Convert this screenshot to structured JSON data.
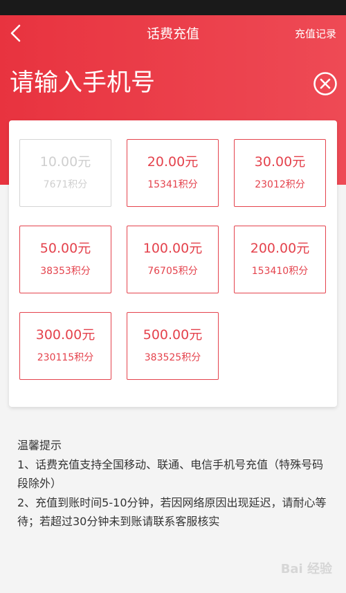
{
  "header": {
    "title": "话费充值",
    "records_link": "充值记录",
    "phone_placeholder": "请输入手机号",
    "background_color": "#e8333f"
  },
  "options": [
    {
      "amount": "10.00元",
      "points": "7671积分",
      "disabled": true
    },
    {
      "amount": "20.00元",
      "points": "15341积分",
      "disabled": false
    },
    {
      "amount": "30.00元",
      "points": "23012积分",
      "disabled": false
    },
    {
      "amount": "50.00元",
      "points": "38353积分",
      "disabled": false
    },
    {
      "amount": "100.00元",
      "points": "76705积分",
      "disabled": false
    },
    {
      "amount": "200.00元",
      "points": "153410积分",
      "disabled": false
    },
    {
      "amount": "300.00元",
      "points": "230115积分",
      "disabled": false
    },
    {
      "amount": "500.00元",
      "points": "383525积分",
      "disabled": false
    }
  ],
  "tips": {
    "title": "温馨提示",
    "items": [
      "1、话费充值支持全国移动、联通、电信手机号充值（特殊号码段除外）",
      "2、充值到账时间5-10分钟，若因网络原因出现延迟，请耐心等待；若超过30分钟未到账请联系客服核实"
    ]
  },
  "watermark": "Bai 经验",
  "colors": {
    "accent": "#e4424c",
    "disabled": "#cfcfcf",
    "page_bg": "#f4f4f4"
  },
  "icons": {
    "back": "chevron-left-icon",
    "clear": "close-circle-icon"
  }
}
